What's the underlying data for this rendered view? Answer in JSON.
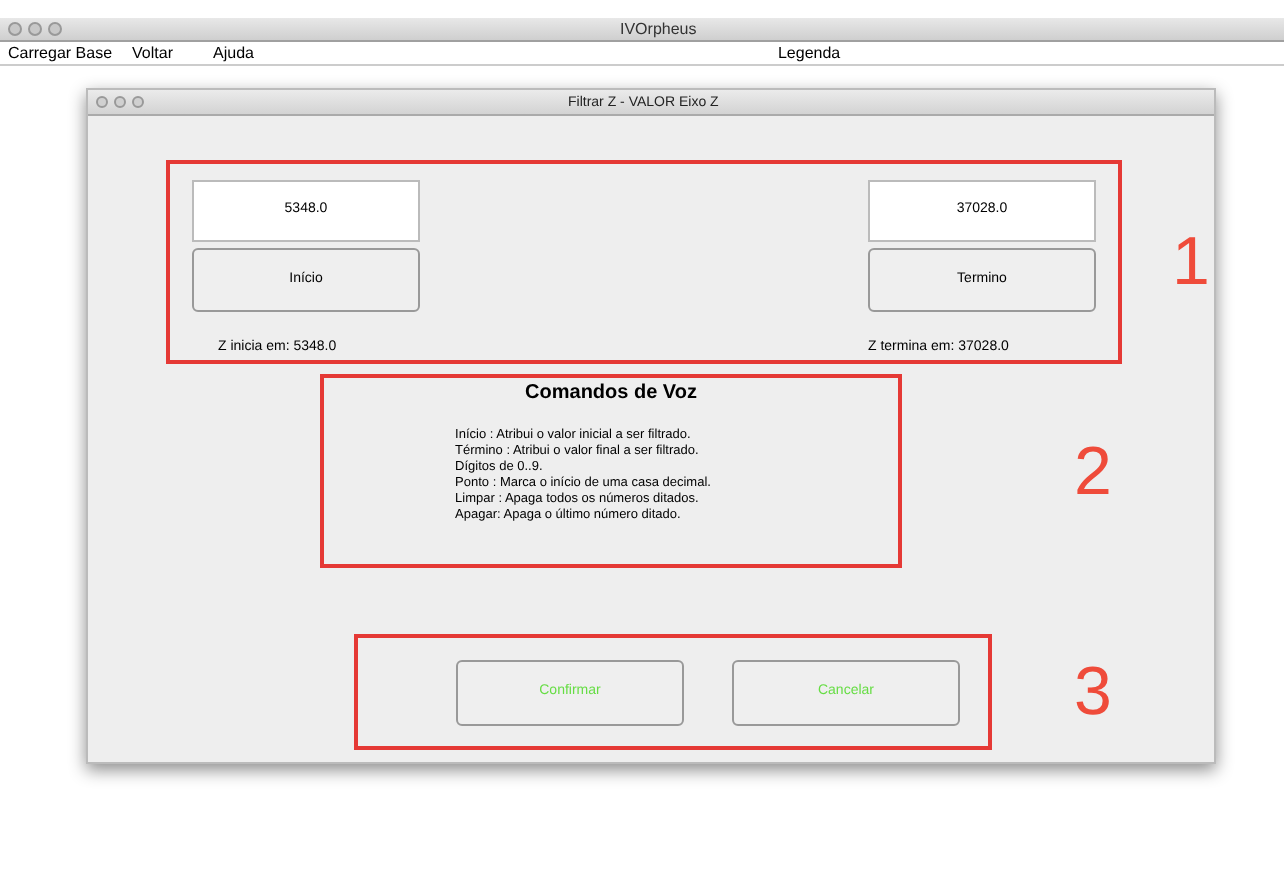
{
  "window": {
    "title": "IVOrpheus"
  },
  "menu": [
    {
      "label": "Carregar Base"
    },
    {
      "label": "Voltar"
    },
    {
      "label": "Ajuda"
    },
    {
      "label": "Legenda"
    }
  ],
  "dialog": {
    "title": "Filtrar Z - VALOR Eixo Z",
    "start": {
      "value": "5348.0",
      "button": "Início",
      "caption": "Z inicia em: 5348.0"
    },
    "end": {
      "value": "37028.0",
      "button": "Termino",
      "caption": "Z termina em: 37028.0"
    },
    "voice": {
      "heading": "Comandos de Voz",
      "lines": [
        "Início : Atribui o valor inicial a ser filtrado.",
        "Término : Atribui o valor final a ser filtrado.",
        "Dígitos de 0..9.",
        "Ponto : Marca o início de uma casa decimal.",
        "Limpar : Apaga todos os números ditados.",
        "Apagar: Apaga o último número ditado."
      ]
    },
    "buttons": [
      {
        "label": "Confirmar"
      },
      {
        "label": "Cancelar"
      }
    ]
  },
  "annotations": [
    "1",
    "2",
    "3"
  ]
}
